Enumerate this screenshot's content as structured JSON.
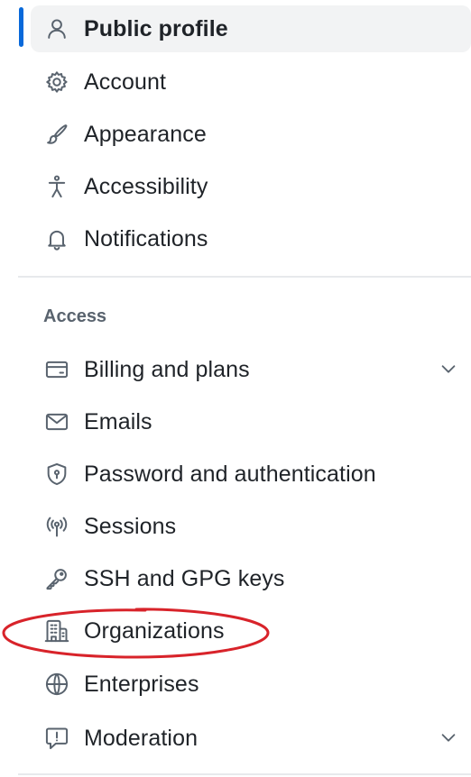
{
  "sidebar": {
    "primary_items": [
      {
        "label": "Public profile",
        "icon": "person-icon",
        "active": true
      },
      {
        "label": "Account",
        "icon": "gear-icon"
      },
      {
        "label": "Appearance",
        "icon": "paintbrush-icon"
      },
      {
        "label": "Accessibility",
        "icon": "accessibility-icon"
      },
      {
        "label": "Notifications",
        "icon": "bell-icon"
      }
    ],
    "access_section": {
      "title": "Access",
      "items": [
        {
          "label": "Billing and plans",
          "icon": "credit-card-icon",
          "expandable": true
        },
        {
          "label": "Emails",
          "icon": "mail-icon"
        },
        {
          "label": "Password and authentication",
          "icon": "shield-lock-icon"
        },
        {
          "label": "Sessions",
          "icon": "broadcast-icon"
        },
        {
          "label": "SSH and GPG keys",
          "icon": "key-icon"
        },
        {
          "label": "Organizations",
          "icon": "organization-icon",
          "highlighted": true
        },
        {
          "label": "Enterprises",
          "icon": "globe-icon"
        },
        {
          "label": "Moderation",
          "icon": "report-icon",
          "expandable": true
        }
      ]
    }
  },
  "colors": {
    "active_indicator": "#0969da",
    "active_background": "#f2f3f4",
    "annotation_circle": "#d8232a"
  }
}
